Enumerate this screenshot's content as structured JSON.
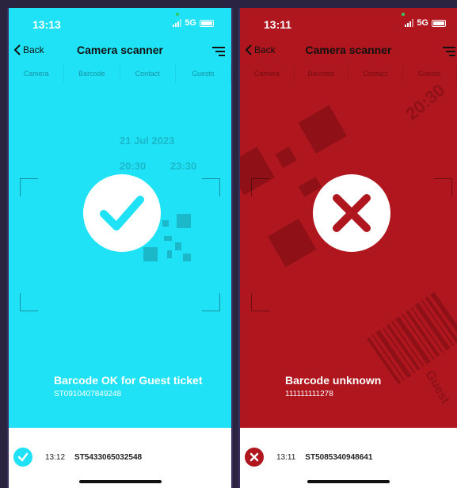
{
  "screens": [
    {
      "status": {
        "time": "13:13",
        "network": "5G"
      },
      "nav": {
        "back_label": "Back",
        "title": "Camera scanner"
      },
      "tabs": [
        "Camera",
        "Barcode",
        "Contact",
        "Guests"
      ],
      "ticket_hint": {
        "date": "21 Jul 2023",
        "time_a": "20:30",
        "time_b": "23:30"
      },
      "result": {
        "status": "success",
        "icon": "check-icon",
        "color": "#20e2f6"
      },
      "message": {
        "title": "Barcode OK for Guest ticket",
        "code": "ST0910407849248"
      },
      "history": {
        "time": "13:12",
        "code": "ST5433065032548",
        "icon": "check-icon",
        "color": "#20e2f6"
      }
    },
    {
      "status": {
        "time": "13:11",
        "network": "5G"
      },
      "nav": {
        "back_label": "Back",
        "title": "Camera scanner"
      },
      "tabs": [
        "Camera",
        "Barcode",
        "Contact",
        "Guests"
      ],
      "ticket_hint": {
        "time_a": "20:30",
        "label": "Guest"
      },
      "result": {
        "status": "error",
        "icon": "cross-icon",
        "color": "#b0161d"
      },
      "message": {
        "title": "Barcode unknown",
        "code": "111111111278"
      },
      "history": {
        "time": "13:11",
        "code": "ST5085340948641",
        "icon": "cross-icon",
        "color": "#b0161d"
      }
    }
  ]
}
